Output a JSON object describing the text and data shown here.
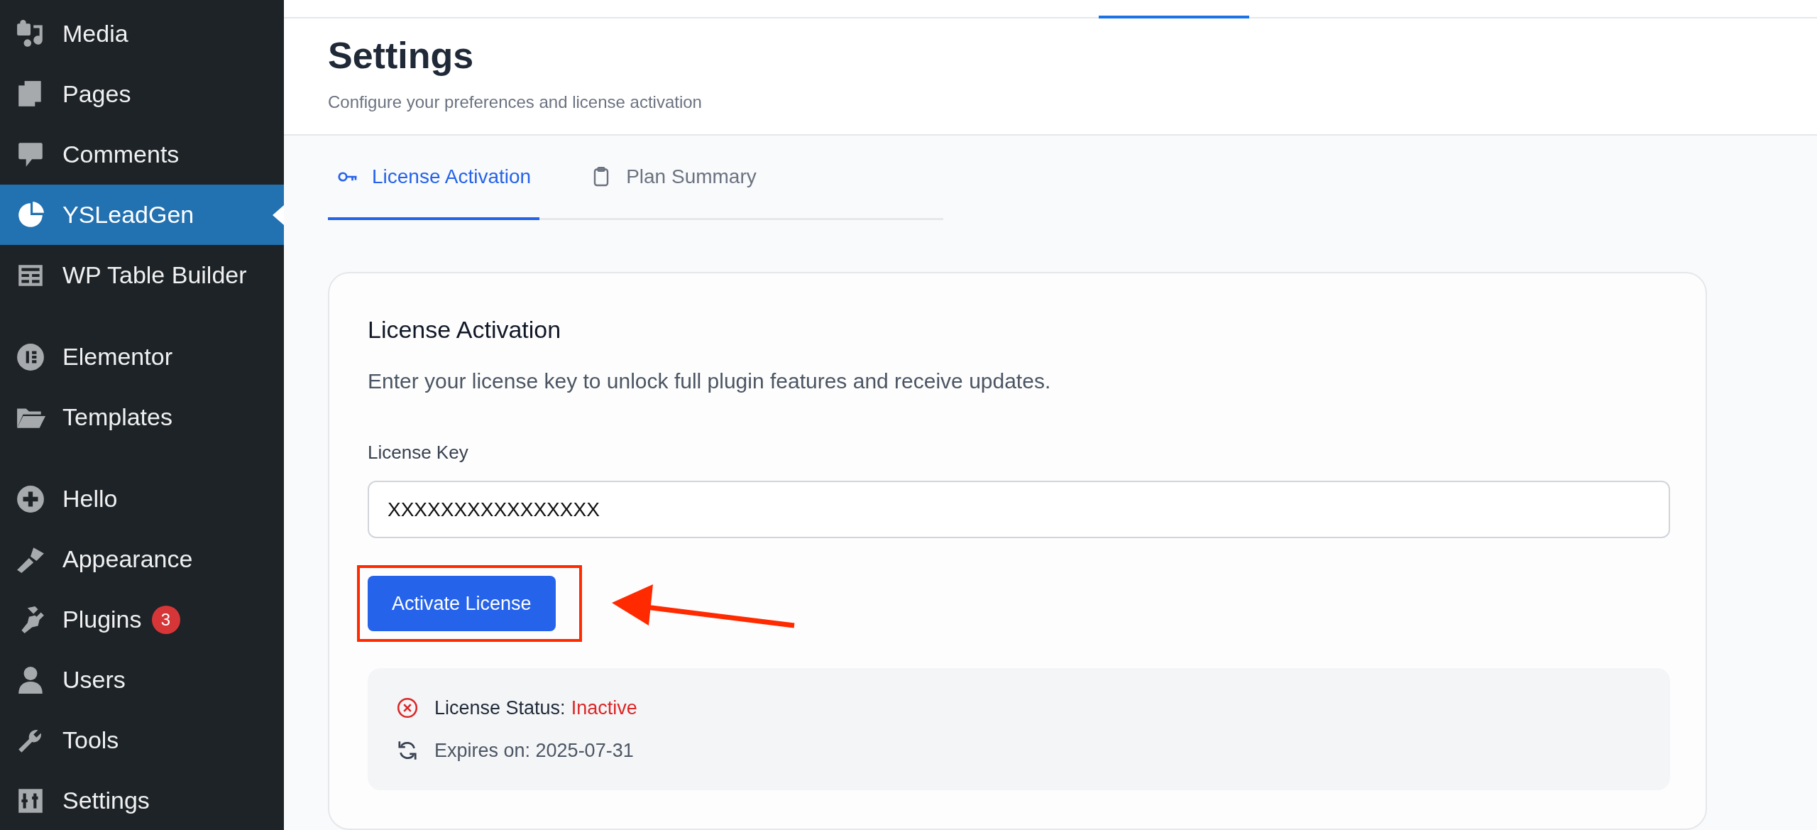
{
  "sidebar": {
    "groups": [
      [
        {
          "label": "Media",
          "selected": false
        },
        {
          "label": "Pages",
          "selected": false
        },
        {
          "label": "Comments",
          "selected": false
        },
        {
          "label": "YSLeadGen",
          "selected": true
        },
        {
          "label": "WP Table Builder",
          "selected": false
        }
      ],
      [
        {
          "label": "Elementor",
          "selected": false
        },
        {
          "label": "Templates",
          "selected": false
        }
      ],
      [
        {
          "label": "Hello",
          "selected": false
        },
        {
          "label": "Appearance",
          "selected": false
        },
        {
          "label": "Plugins",
          "selected": false,
          "badge": "3"
        },
        {
          "label": "Users",
          "selected": false
        },
        {
          "label": "Tools",
          "selected": false
        },
        {
          "label": "Settings",
          "selected": false
        }
      ]
    ]
  },
  "header": {
    "title": "Settings",
    "subtitle": "Configure your preferences and license activation"
  },
  "tabs": [
    {
      "label": "License Activation",
      "selected": true
    },
    {
      "label": "Plan Summary",
      "selected": false
    }
  ],
  "card": {
    "title": "License Activation",
    "description": "Enter your license key to unlock full plugin features and receive updates.",
    "field_label": "License Key",
    "field_value": "XXXXXXXXXXXXXXXX",
    "button": "Activate License",
    "status": [
      {
        "kind": "status",
        "label": "License Status:",
        "value": "Inactive",
        "active": false
      },
      {
        "kind": "expiry",
        "label": "Expires on: 2025-07-31"
      }
    ]
  },
  "annotation": {
    "highlight_box": true,
    "arrow": true
  }
}
